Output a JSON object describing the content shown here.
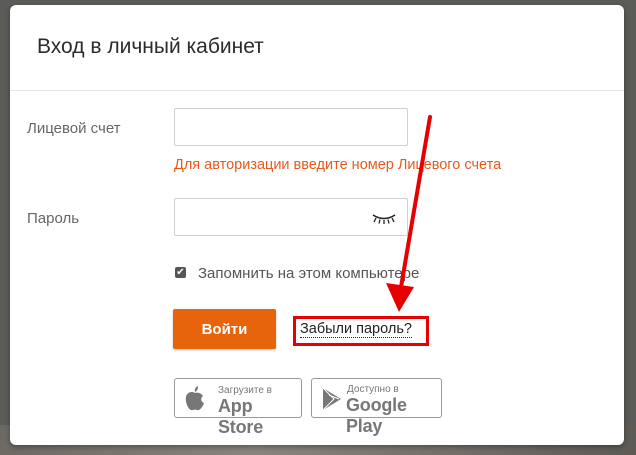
{
  "dialog": {
    "title": "Вход в личный кабинет",
    "account_label": "Лицевой счет",
    "account_value": "",
    "account_hint": "Для авторизации введите номер Лицевого счета",
    "password_label": "Пароль",
    "password_value": "",
    "remember_label": "Запомнить на этом компьютере",
    "remember_checked": true,
    "login_button": "Войти",
    "forgot_link": "Забыли пароль?"
  },
  "stores": {
    "apple": {
      "small": "Загрузите в",
      "big": "App Store",
      "icon": "apple-icon"
    },
    "google": {
      "small": "Доступно в",
      "big": "Google Play",
      "icon": "google-play-icon"
    }
  },
  "colors": {
    "accent": "#e8640c",
    "hint": "#e8591c",
    "annotation": "#e60000"
  }
}
